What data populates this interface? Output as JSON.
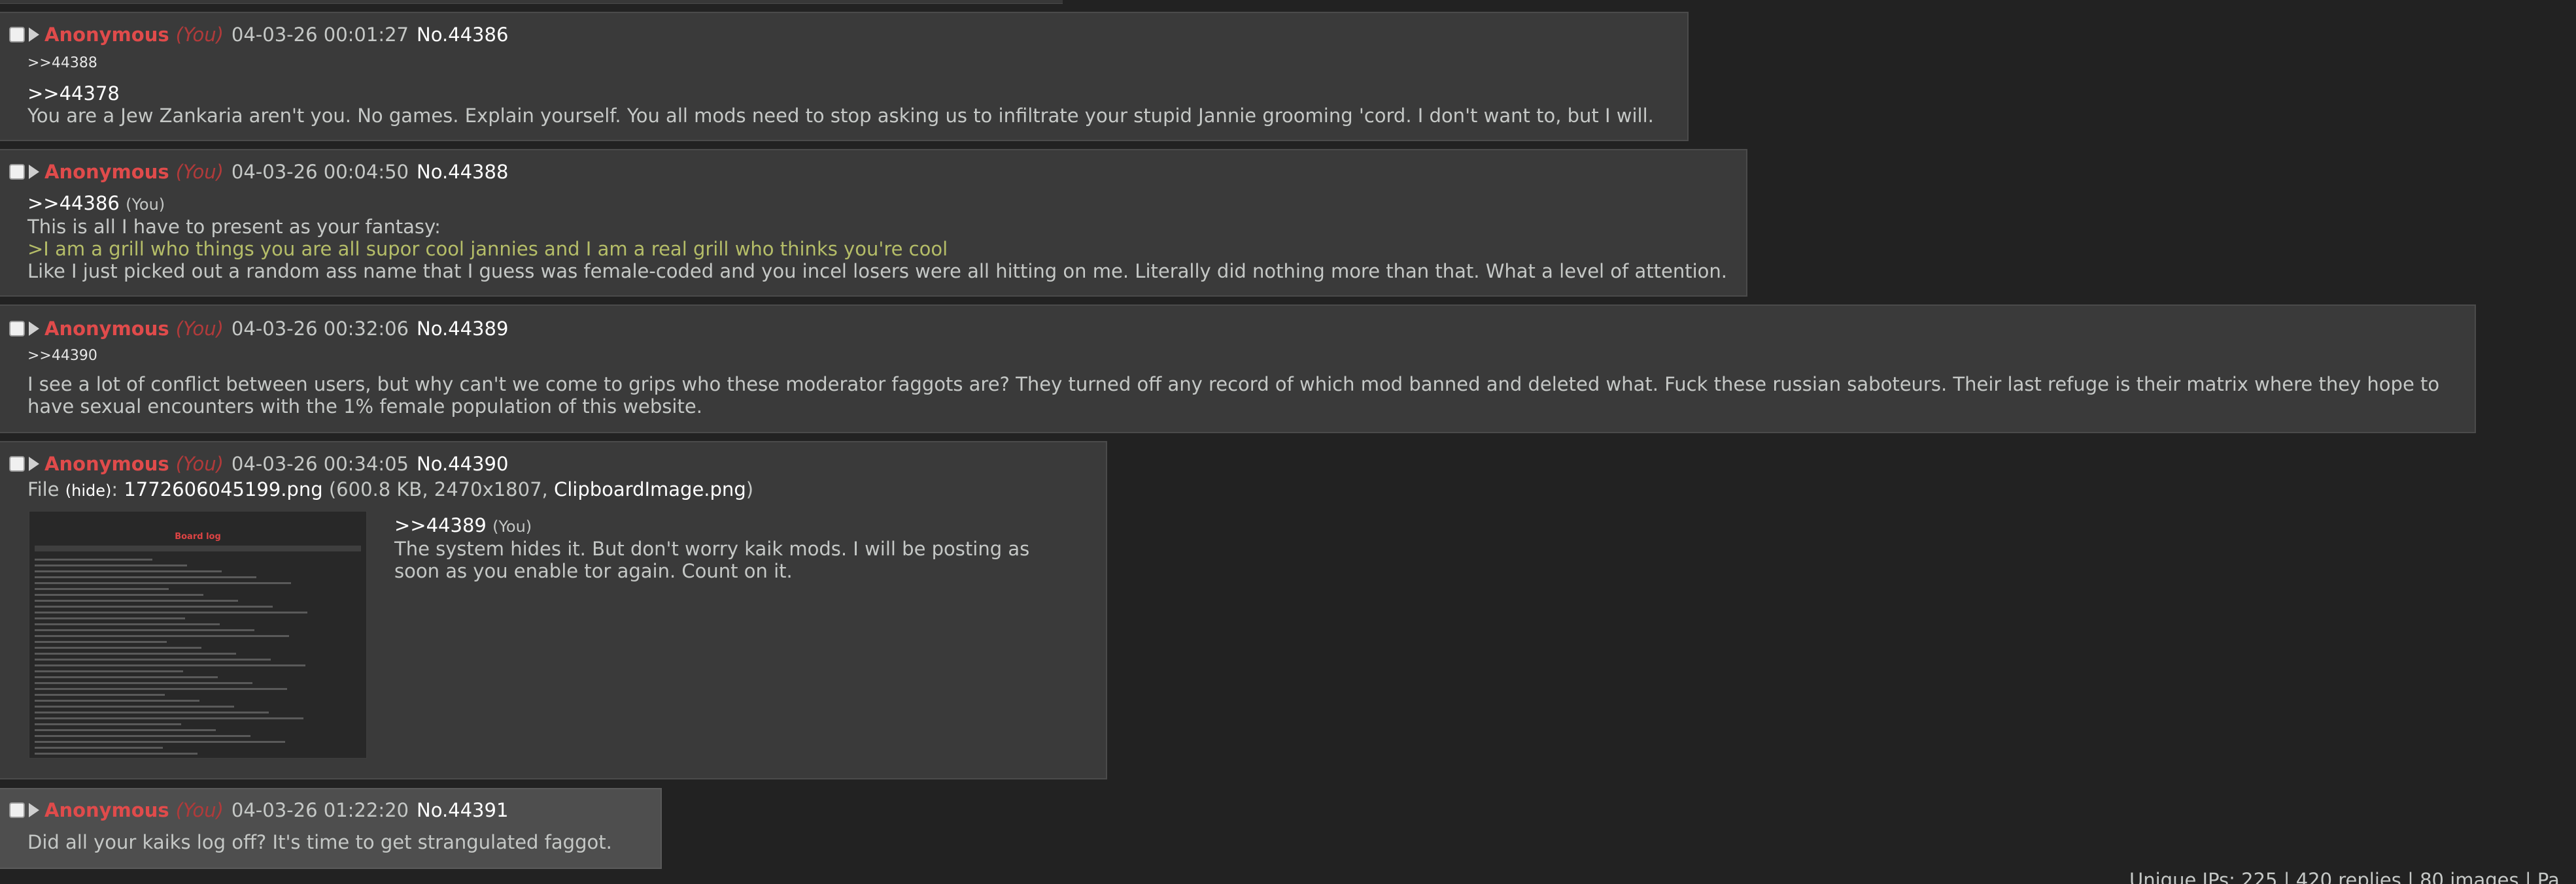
{
  "posts": [
    {
      "name": "Anonymous",
      "you": "(You)",
      "date": "04-03-26 00:01:27",
      "number": "No.44386",
      "backlinks": ">>44388",
      "quote": ">>44378",
      "lines": [
        "You are a Jew Zankaria aren't you. No games. Explain yourself. You all mods need to stop asking us to infiltrate your stupid Jannie grooming 'cord. I don't want to, but I will."
      ]
    },
    {
      "name": "Anonymous",
      "you": "(You)",
      "date": "04-03-26 00:04:50",
      "number": "No.44388",
      "quote": ">>44386",
      "quote_you": "(You)",
      "lines": [
        "This is all I have to present as your fantasy:"
      ],
      "greentext": ">I am a grill who things you are all supor cool jannies and I am a real grill who thinks you're cool",
      "after": "Like I just picked out a random ass name that I guess was female-coded and you incel losers were all hitting on me. Literally did nothing more than that. What a level of attention."
    },
    {
      "name": "Anonymous",
      "you": "(You)",
      "date": "04-03-26 00:32:06",
      "number": "No.44389",
      "backlinks": ">>44390",
      "lines": [
        "I see a lot of conflict between users, but why can't we come to grips who these moderator faggots are? They turned off any record of which mod banned and deleted what. Fuck these russian saboteurs. Their last refuge is their matrix where they hope to",
        "have sexual encounters with the 1% female population of this website."
      ]
    },
    {
      "name": "Anonymous",
      "you": "(You)",
      "date": "04-03-26 00:34:05",
      "number": "No.44390",
      "file": {
        "label": "File ",
        "hide": "(hide)",
        "colon": ": ",
        "filename": "1772606045199.png",
        "meta_open": " (600.8 KB, 2470x1807, ",
        "original": "ClipboardImage.png",
        "meta_close": ")"
      },
      "thumb_title": "Board log",
      "quote": ">>44389",
      "quote_you": "(You)",
      "lines": [
        "The system hides it. But don't worry kaik mods. I will be posting as",
        "soon as you enable tor again. Count on it."
      ]
    },
    {
      "name": "Anonymous",
      "you": "(You)",
      "date": "04-03-26 01:22:20",
      "number": "No.44391",
      "lines": [
        "Did all your kaiks log off? It's time to get strangulated faggot."
      ]
    }
  ],
  "footer": {
    "stats": "Unique IPs: 225  | 420 replies | 80 images | Pa"
  },
  "colors": {
    "background": "#222222",
    "post_bg": "#3a3a3a",
    "highlighted_post_bg": "#4e4e4e",
    "name": "#e04b4b",
    "greentext": "#b5bd68"
  }
}
